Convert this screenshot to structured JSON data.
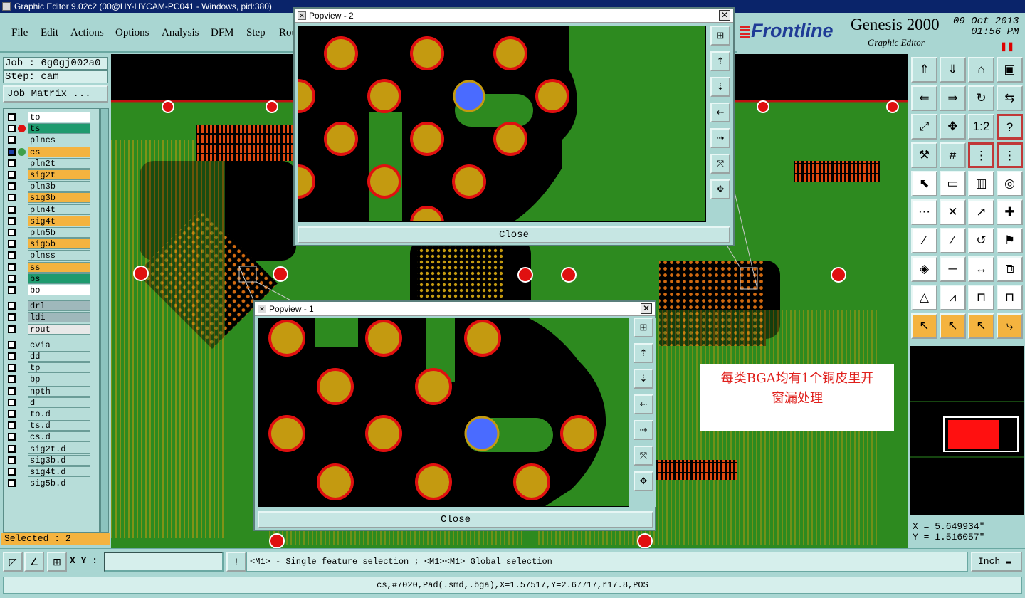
{
  "window": {
    "title": "Graphic Editor 9.02c2 (00@HY-HYCAM-PC041 - Windows, pid:380)"
  },
  "menu": [
    "File",
    "Edit",
    "Actions",
    "Options",
    "Analysis",
    "DFM",
    "Step",
    "Rou"
  ],
  "brand": {
    "logo": "Frontline",
    "product": "Genesis 2000",
    "subtitle": "Graphic Editor",
    "date": "09 Oct 2013",
    "time": "01:56 PM",
    "stop_icon": "pause-icon"
  },
  "job": {
    "job_label": "Job : 6g0gj002a0",
    "step_label": "Step: cam",
    "matrix_button": "Job Matrix ..."
  },
  "layers": [
    {
      "name": "to",
      "color": "#ffffff",
      "status": "red-dot-none"
    },
    {
      "name": "ts",
      "color": "#1e9a6e",
      "dot": "#e01010"
    },
    {
      "name": "plncs",
      "color": "#b7ddd9"
    },
    {
      "name": "cs",
      "color": "#f4b33f",
      "active": true
    },
    {
      "name": "pln2t",
      "color": "#b7ddd9"
    },
    {
      "name": "sig2t",
      "color": "#f4b33f"
    },
    {
      "name": "pln3b",
      "color": "#b7ddd9"
    },
    {
      "name": "sig3b",
      "color": "#f4b33f"
    },
    {
      "name": "pln4t",
      "color": "#b7ddd9"
    },
    {
      "name": "sig4t",
      "color": "#f4b33f"
    },
    {
      "name": "pln5b",
      "color": "#b7ddd9"
    },
    {
      "name": "sig5b",
      "color": "#f4b33f"
    },
    {
      "name": "plnss",
      "color": "#b7ddd9"
    },
    {
      "name": "ss",
      "color": "#f4b33f"
    },
    {
      "name": "bs",
      "color": "#1e9a6e"
    },
    {
      "name": "bo",
      "color": "#ffffff"
    },
    {
      "name": "drl",
      "color": "#9fb8bb"
    },
    {
      "name": "ldi",
      "color": "#9fb8bb"
    },
    {
      "name": "rout",
      "color": "#e8e8e8"
    },
    {
      "name": "cvia",
      "color": "#b7ddd9"
    },
    {
      "name": "dd",
      "color": "#b7ddd9"
    },
    {
      "name": "tp",
      "color": "#b7ddd9"
    },
    {
      "name": "bp",
      "color": "#b7ddd9"
    },
    {
      "name": "npth",
      "color": "#b7ddd9"
    },
    {
      "name": "d",
      "color": "#b7ddd9"
    },
    {
      "name": "to.d",
      "color": "#b7ddd9"
    },
    {
      "name": "ts.d",
      "color": "#b7ddd9"
    },
    {
      "name": "cs.d",
      "color": "#b7ddd9"
    },
    {
      "name": "sig2t.d",
      "color": "#b7ddd9"
    },
    {
      "name": "sig3b.d",
      "color": "#b7ddd9"
    },
    {
      "name": "sig4t.d",
      "color": "#b7ddd9"
    },
    {
      "name": "sig5b.d",
      "color": "#b7ddd9"
    }
  ],
  "selected": "Selected : 2",
  "popup2": {
    "title": "Popview - 2",
    "close": "Close"
  },
  "popup1": {
    "title": "Popview - 1",
    "close": "Close"
  },
  "annotation": {
    "line1": "每类BGA均有1个铜皮里开",
    "line2": "窗漏处理"
  },
  "coords": {
    "x": "X = 5.649934\"",
    "y": "Y = 1.516057\""
  },
  "command": {
    "xy_label": "X Y :",
    "xy_value": "",
    "hint": "<M1> - Single feature selection ; <M1><M1> Global selection",
    "units": "Inch"
  },
  "status": "cs,#7020,Pad(.smd,.bga),X=1.57517,Y=2.67717,r17.8,POS",
  "colors": {
    "board": "#2d8a1f",
    "copper_pad": "#c49a10",
    "pad_ring": "#e01010",
    "selected_pad": "#4a6bff",
    "void": "#000000",
    "ui": "#a9d6d2"
  }
}
